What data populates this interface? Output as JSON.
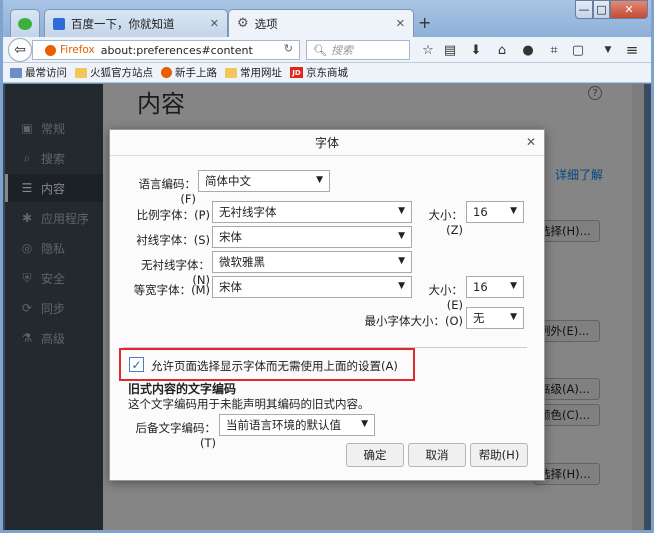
{
  "window": {
    "tabs": [
      {
        "label": "百度一下，你就知道"
      },
      {
        "label": "选项"
      }
    ],
    "new_tab": "+",
    "controls": {
      "minimize": "—",
      "maximize": "□",
      "close": "✕"
    }
  },
  "navbar": {
    "identity": "Firefox",
    "url": "about:preferences#content",
    "search_placeholder": "搜索"
  },
  "bookmarks": [
    {
      "label": "最常访问"
    },
    {
      "label": "火狐官方站点"
    },
    {
      "label": "新手上路"
    },
    {
      "label": "常用网址"
    },
    {
      "label": "京东商城"
    }
  ],
  "sidebar": {
    "items": [
      {
        "label": "常规",
        "icon": "general-icon"
      },
      {
        "label": "搜索",
        "icon": "search-icon"
      },
      {
        "label": "内容",
        "icon": "content-icon"
      },
      {
        "label": "应用程序",
        "icon": "applications-icon"
      },
      {
        "label": "隐私",
        "icon": "privacy-icon"
      },
      {
        "label": "安全",
        "icon": "security-icon"
      },
      {
        "label": "同步",
        "icon": "sync-icon"
      },
      {
        "label": "高级",
        "icon": "advanced-icon"
      }
    ],
    "active_index": 2
  },
  "page": {
    "heading": "内容",
    "learn_more": "详细了解",
    "bg_buttons": [
      "选择(H)...",
      "例外(E)...",
      "高级(A)...",
      "颜色(C)...",
      "选择(H)..."
    ]
  },
  "dialog": {
    "title": "字体",
    "encoding_label": "语言编码：(F)",
    "encoding_value": "简体中文",
    "proportional_label": "比例字体：(P)",
    "proportional_value": "无衬线字体",
    "size_label1": "大小：(Z)",
    "size_value1": "16",
    "serif_label": "衬线字体：(S)",
    "serif_value": "宋体",
    "sans_label": "无衬线字体：(N)",
    "sans_value": "微软雅黑",
    "mono_label": "等宽字体：(M)",
    "mono_value": "宋体",
    "size_label2": "大小：(E)",
    "size_value2": "16",
    "min_size_label": "最小字体大小：(O)",
    "min_size_value": "无",
    "allow_pages_label": "允许页面选择显示字体而无需使用上面的设置(A)",
    "allow_pages_checked": true,
    "legacy_heading": "旧式内容的文字编码",
    "legacy_desc": "这个文字编码用于未能声明其编码的旧式内容。",
    "fallback_label": "后备文字编码：(T)",
    "fallback_value": "当前语言环境的默认值",
    "ok": "确定",
    "cancel": "取消",
    "help": "帮助(H)"
  },
  "colors": {
    "sidebar_bg": "#424f5a",
    "highlight_border": "#e0282e",
    "link": "#0a84ff",
    "firefox_orange": "#e66000"
  }
}
